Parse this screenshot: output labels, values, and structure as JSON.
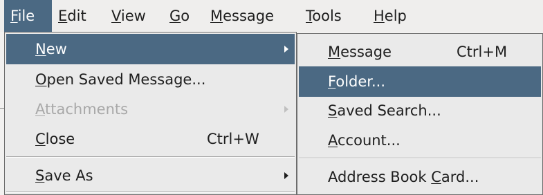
{
  "menubar": {
    "items": [
      {
        "name": "file",
        "pre": "",
        "key": "F",
        "post": "ile"
      },
      {
        "name": "edit",
        "pre": "",
        "key": "E",
        "post": "dit"
      },
      {
        "name": "view",
        "pre": "",
        "key": "V",
        "post": "iew"
      },
      {
        "name": "go",
        "pre": "",
        "key": "G",
        "post": "o"
      },
      {
        "name": "message",
        "pre": "",
        "key": "M",
        "post": "essage"
      },
      {
        "name": "tools",
        "pre": "",
        "key": "T",
        "post": "ools"
      },
      {
        "name": "help",
        "pre": "",
        "key": "H",
        "post": "elp"
      }
    ]
  },
  "file_menu": {
    "new": {
      "pre": "",
      "key": "N",
      "post": "ew"
    },
    "open_saved": {
      "pre": "",
      "key": "O",
      "post": "pen Saved Message..."
    },
    "attachments": {
      "pre": "",
      "key": "A",
      "post": "ttachments"
    },
    "close": {
      "pre": "",
      "key": "C",
      "post": "lose",
      "accel": "Ctrl+W"
    },
    "save_as": {
      "pre": "",
      "key": "S",
      "post": "ave As"
    }
  },
  "new_submenu": {
    "message": {
      "pre": "",
      "key": "M",
      "post": "essage",
      "accel": "Ctrl+M"
    },
    "folder": {
      "pre": "",
      "key": "F",
      "post": "older..."
    },
    "saved_search": {
      "pre": "",
      "key": "S",
      "post": "aved Search..."
    },
    "account": {
      "pre": "",
      "key": "A",
      "post": "ccount..."
    },
    "address_book_card": {
      "pre": "Address Book ",
      "key": "C",
      "post": "ard..."
    }
  },
  "colors": {
    "highlight": "#4b6983",
    "menu_bg": "#eaeaea",
    "disabled_text": "#a8a8a8"
  }
}
